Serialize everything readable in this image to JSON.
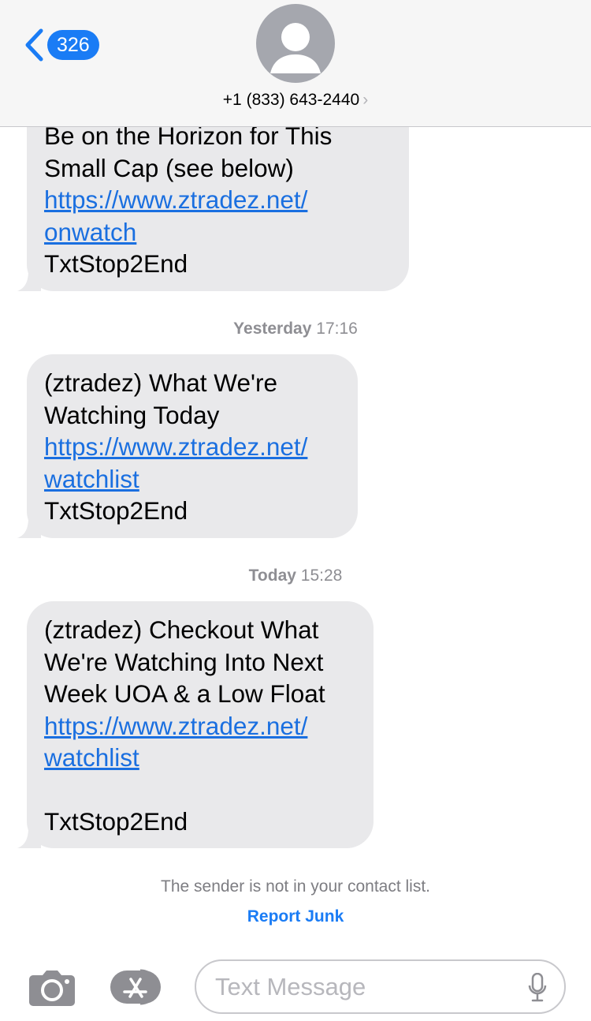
{
  "header": {
    "back_badge": "326",
    "contact_number": "+1 (833) 643-2440",
    "contact_chevron": "›",
    "avatar_icon": "person-silhouette-icon"
  },
  "messages": [
    {
      "lines": [
        "Be on the Horizon for This",
        "Small Cap (see below)"
      ],
      "link_lines": [
        "https://www.ztradez.net/",
        "onwatch"
      ],
      "footer": "TxtStop2End"
    },
    {
      "timestamp_day": "Yesterday",
      "timestamp_time": "17:16",
      "lines": [
        "(ztradez) What We're",
        "Watching Today"
      ],
      "link_lines": [
        "https://www.ztradez.net/",
        "watchlist"
      ],
      "footer": "TxtStop2End"
    },
    {
      "timestamp_day": "Today",
      "timestamp_time": "15:28",
      "lines": [
        "(ztradez) Checkout What",
        "We're Watching Into Next",
        "Week UOA & a Low Float"
      ],
      "link_lines": [
        "https://www.ztradez.net/",
        "watchlist"
      ],
      "footer": "TxtStop2End"
    }
  ],
  "notice": "The sender is not in your contact list.",
  "report_junk": "Report Junk",
  "composer": {
    "placeholder": "Text Message",
    "camera_icon": "camera-icon",
    "appstore_icon": "app-store-icon",
    "mic_icon": "microphone-icon"
  },
  "colors": {
    "accent": "#1a7cf5",
    "bubble": "#e9e9eb",
    "link": "#1a6fe0",
    "header_bg": "#f6f6f6"
  }
}
